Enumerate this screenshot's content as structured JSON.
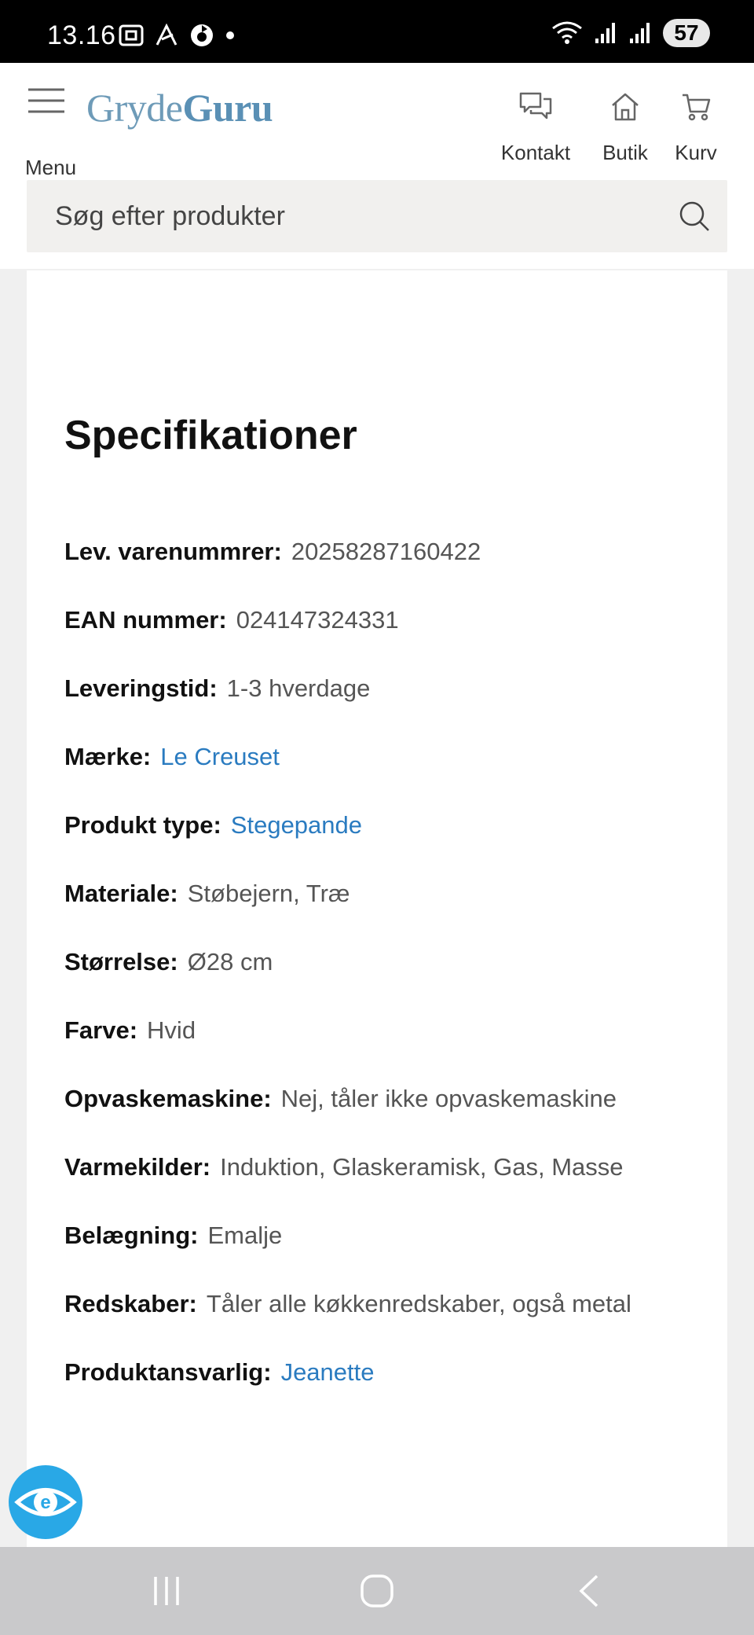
{
  "status_bar": {
    "time": "13.16",
    "battery": "57",
    "icons": [
      "screenshot-icon",
      "app-icon",
      "sync-icon",
      "dot-icon",
      "wifi-icon",
      "signal-icon",
      "signal-icon"
    ]
  },
  "header": {
    "menu_label": "Menu",
    "logo_part1": "Gryde",
    "logo_part2": "Guru",
    "nav": {
      "kontakt": "Kontakt",
      "butik": "Butik",
      "kurv": "Kurv"
    },
    "search_placeholder": "Søg efter produkter"
  },
  "specifications": {
    "title": "Specifikationer",
    "rows": [
      {
        "label": "Lev. varenummrer:",
        "value": "20258287160422",
        "link": false
      },
      {
        "label": "EAN nummer:",
        "value": "024147324331",
        "link": false
      },
      {
        "label": "Leveringstid:",
        "value": "1-3 hverdage",
        "link": false
      },
      {
        "label": "Mærke:",
        "value": "Le Creuset",
        "link": true
      },
      {
        "label": "Produkt type:",
        "value": "Stegepande",
        "link": true
      },
      {
        "label": "Materiale:",
        "value": "Støbejern, Træ",
        "link": false
      },
      {
        "label": "Størrelse:",
        "value": "Ø28 cm",
        "link": false
      },
      {
        "label": "Farve:",
        "value": "Hvid",
        "link": false
      },
      {
        "label": "Opvaskemaskine:",
        "value": "Nej, tåler ikke opvaskemaskine",
        "link": false
      },
      {
        "label": "Varmekilder:",
        "value": "Induktion, Glaskeramisk, Gas, Masse",
        "link": false
      },
      {
        "label": "Belægning:",
        "value": "Emalje",
        "link": false
      },
      {
        "label": "Redskaber:",
        "value": "Tåler alle køkkenredskaber, også metal",
        "link": false
      },
      {
        "label": "Produktansvarlig:",
        "value": "Jeanette",
        "link": true
      }
    ]
  },
  "colors": {
    "link": "#2a7bc0",
    "logo": "#5a90b5",
    "accessibility": "#29a8e6"
  }
}
